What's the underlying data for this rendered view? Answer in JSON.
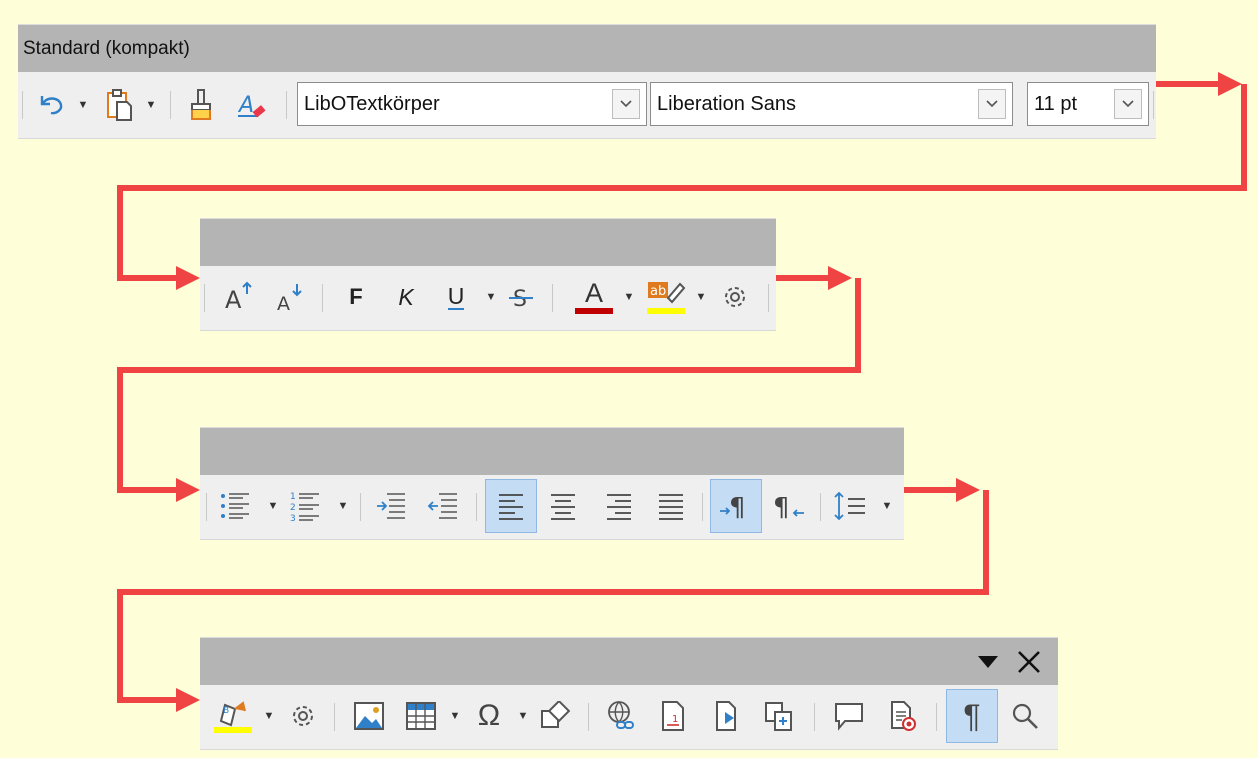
{
  "toolbar": {
    "title": "Standard (kompakt)",
    "paragraph_style": "LibOTextkörper",
    "font_name": "Liberation Sans",
    "font_size": "11 pt"
  },
  "format_row": {
    "bold_label": "F",
    "italic_label": "K",
    "underline_label": "U",
    "font_color_label": "A",
    "highlight_label": "ab"
  },
  "colors": {
    "background": "#FEFED8",
    "titlebar": "#B4B4B4",
    "toolbar": "#EFEFEF",
    "arrow": "#F04444",
    "active": "#C5DDF4",
    "font_color_bar": "#C00000",
    "highlight_bar": "#FFFF00",
    "icon_blue": "#2F80C8"
  }
}
